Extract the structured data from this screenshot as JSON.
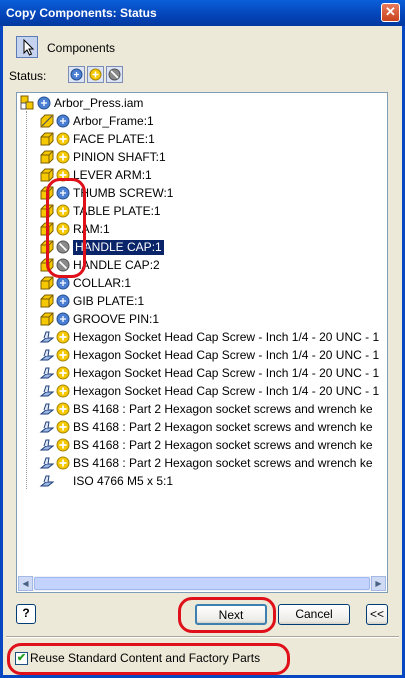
{
  "window": {
    "title": "Copy Components: Status",
    "close_glyph": "✕"
  },
  "toolbar": {
    "components_label": "Components",
    "status_label": "Status:"
  },
  "tree": {
    "root": "Arbor_Press.iam",
    "items": [
      {
        "label": "Arbor_Frame:1",
        "icon": "frame-part",
        "status": "blue",
        "selected": false
      },
      {
        "label": "FACE PLATE:1",
        "icon": "part",
        "status": "yellow",
        "selected": false
      },
      {
        "label": "PINION SHAFT:1",
        "icon": "part",
        "status": "yellow",
        "selected": false
      },
      {
        "label": "LEVER ARM:1",
        "icon": "part",
        "status": "yellow",
        "selected": false
      },
      {
        "label": "THUMB SCREW:1",
        "icon": "part",
        "status": "blue",
        "selected": false
      },
      {
        "label": "TABLE PLATE:1",
        "icon": "part",
        "status": "yellow",
        "selected": false
      },
      {
        "label": "RAM:1",
        "icon": "part",
        "status": "yellow",
        "selected": false
      },
      {
        "label": "HANDLE CAP:1",
        "icon": "part",
        "status": "gray",
        "selected": true
      },
      {
        "label": "HANDLE CAP:2",
        "icon": "part",
        "status": "gray",
        "selected": false
      },
      {
        "label": "COLLAR:1",
        "icon": "part",
        "status": "blue",
        "selected": false
      },
      {
        "label": "GIB PLATE:1",
        "icon": "part",
        "status": "blue",
        "selected": false
      },
      {
        "label": "GROOVE PIN:1",
        "icon": "part",
        "status": "blue",
        "selected": false
      },
      {
        "label": "Hexagon Socket Head Cap Screw - Inch 1/4 - 20 UNC - 1",
        "icon": "library",
        "status": "yellow",
        "selected": false
      },
      {
        "label": "Hexagon Socket Head Cap Screw - Inch 1/4 - 20 UNC - 1",
        "icon": "library",
        "status": "yellow",
        "selected": false
      },
      {
        "label": "Hexagon Socket Head Cap Screw - Inch 1/4 - 20 UNC - 1",
        "icon": "library",
        "status": "yellow",
        "selected": false
      },
      {
        "label": "Hexagon Socket Head Cap Screw - Inch 1/4 - 20 UNC - 1",
        "icon": "library",
        "status": "yellow",
        "selected": false
      },
      {
        "label": "BS 4168 : Part 2 Hexagon socket screws and wrench ke",
        "icon": "library",
        "status": "yellow",
        "selected": false
      },
      {
        "label": "BS 4168 : Part 2 Hexagon socket screws and wrench ke",
        "icon": "library",
        "status": "yellow",
        "selected": false
      },
      {
        "label": "BS 4168 : Part 2 Hexagon socket screws and wrench ke",
        "icon": "library",
        "status": "yellow",
        "selected": false
      },
      {
        "label": "BS 4168 : Part 2 Hexagon socket screws and wrench ke",
        "icon": "library",
        "status": "yellow",
        "selected": false
      },
      {
        "label": "ISO 4766 M5 x 5:1",
        "icon": "library",
        "status": "none",
        "selected": false
      }
    ]
  },
  "scrollbar": {
    "left_arrow": "◀",
    "right_arrow": "▶"
  },
  "buttons": {
    "help": "?",
    "next": "Next",
    "cancel": "Cancel",
    "collapse": "<<"
  },
  "options": {
    "reuse_label": "Reuse Standard Content and Factory Parts",
    "reuse_checked": true,
    "check_glyph": "✔"
  },
  "colors": {
    "status_yellow": "#f5c800",
    "status_blue": "#4a7fd4",
    "status_gray": "#8a8a8a",
    "highlight": "#e0101a",
    "selection": "#0a246a"
  }
}
